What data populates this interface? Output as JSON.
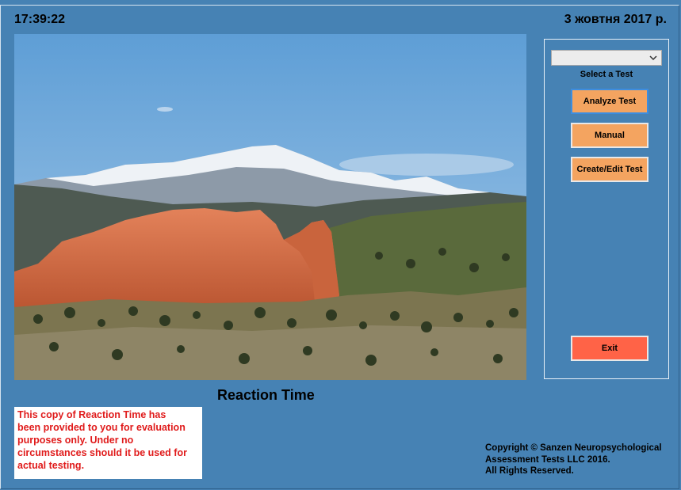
{
  "header": {
    "time": "17:39:22",
    "date": "3 жовтня 2017 р."
  },
  "sidepanel": {
    "test_select_value": "",
    "test_select_label": "Select a Test",
    "analyze_label": "Analyze Test",
    "manual_label": "Manual",
    "create_edit_label": "Create/Edit Test",
    "exit_label": "Exit"
  },
  "main": {
    "app_title": "Reaction Time",
    "notice_lines": [
      "This copy of Reaction Time has",
      "been provided to you for evaluation",
      "purposes only. Under no",
      "circumstances should it be used for",
      "actual testing."
    ],
    "copyright_lines": [
      "Copyright © Sanzen Neuropsychological",
      "Assessment Tests LLC 2016.",
      "All Rights Reserved."
    ]
  },
  "colors": {
    "background": "#4682b4",
    "button": "#f4a460",
    "exit_button": "#ff6347",
    "notice_text": "#e01b1b"
  }
}
